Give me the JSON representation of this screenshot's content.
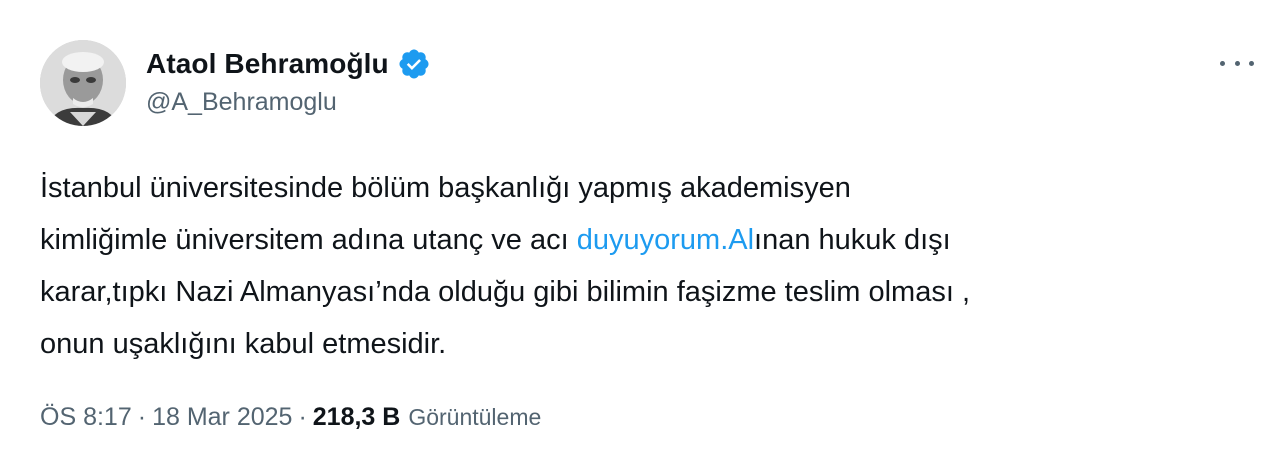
{
  "author": {
    "display_name": "Ataol Behramoğlu",
    "handle": "@A_Behramoglu",
    "verified_color": "#1d9bf0"
  },
  "tweet": {
    "line1": "İstanbul üniversitesinde bölüm başkanlığı yapmış akademisyen",
    "line2_before": "kimliğimle üniversitem adına utanç ve acı ",
    "line2_link": "duyuyorum.Al",
    "line2_after": "ınan hukuk dışı",
    "line3": "karar,tıpkı Nazi Almanyası’nda olduğu gibi bilimin faşizme teslim olması ,",
    "line4": "onun uşaklığını kabul etmesidir."
  },
  "meta": {
    "time": "ÖS 8:17",
    "separator": "·",
    "date": "18 Mar 2025",
    "views_count": "218,3 B",
    "views_label": "Görüntüleme"
  },
  "colors": {
    "text": "#0f1419",
    "secondary": "#536471",
    "link": "#1d9bf0"
  }
}
